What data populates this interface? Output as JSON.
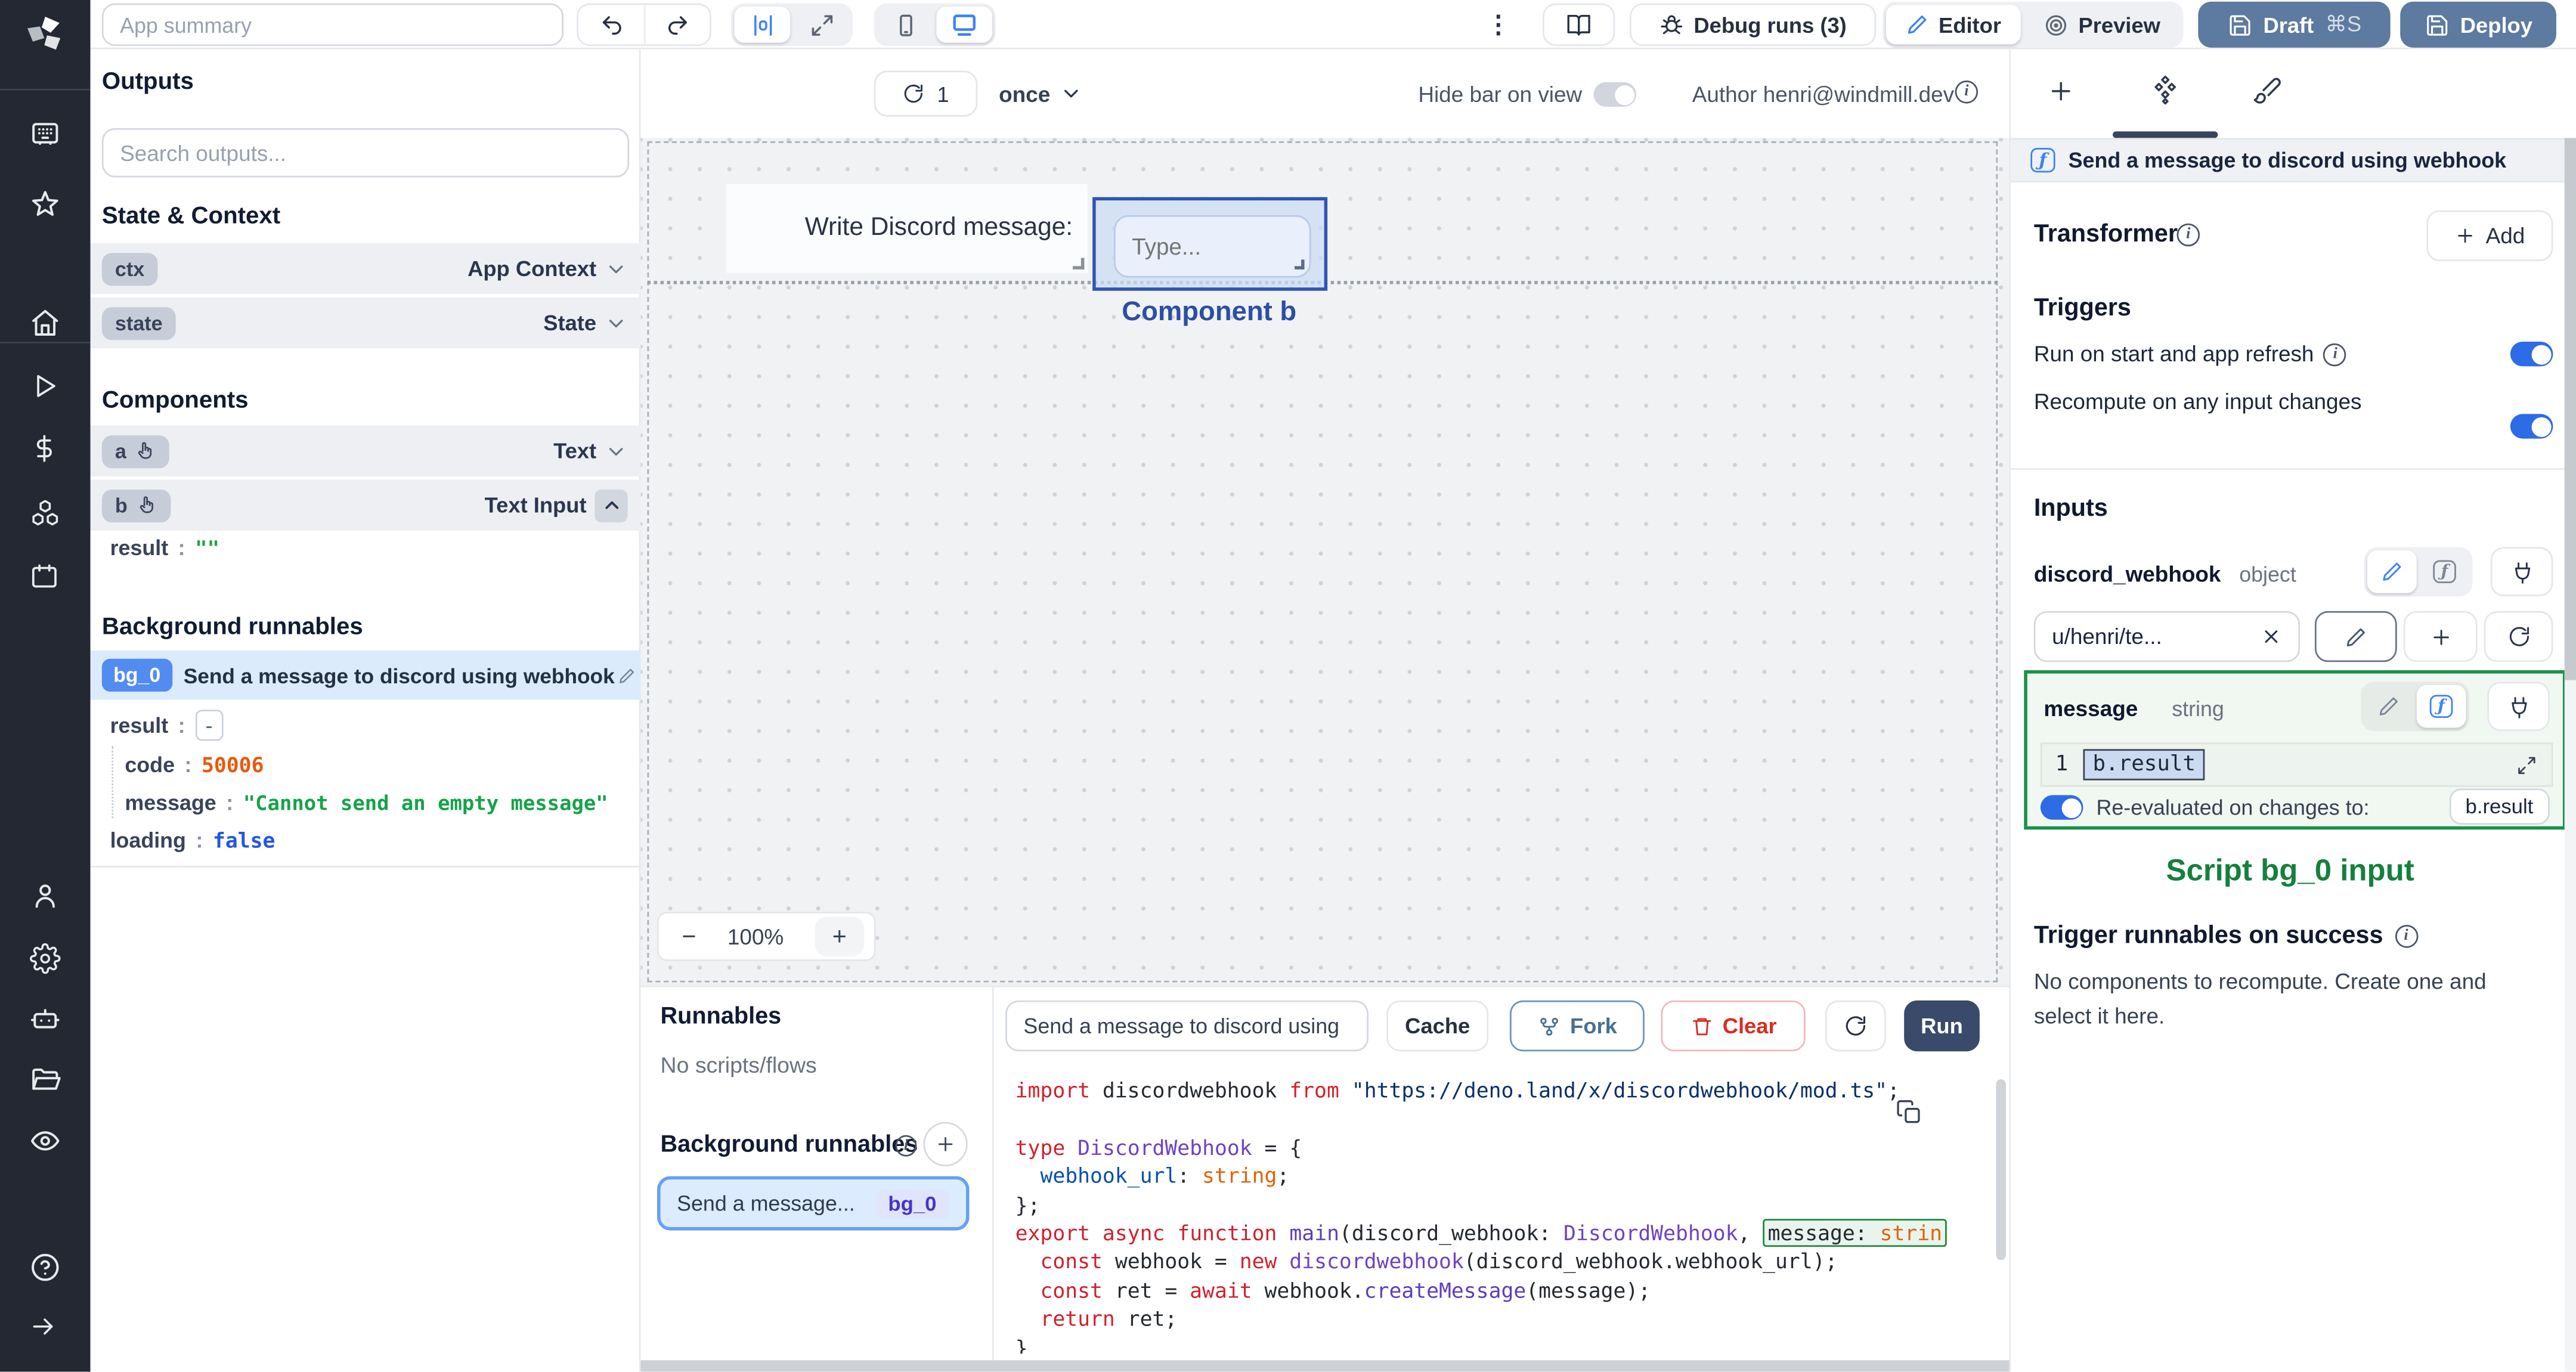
{
  "colors": {
    "accent_blue": "#3b82f6",
    "slate_button": "#5d7aa0",
    "run_button": "#3a4a6b",
    "selection_green": "#199049",
    "component_blue": "#2e55b2",
    "bg0_badge_blue": "#538cf0",
    "code_orange": "#e8590c",
    "code_green": "#16a34a",
    "code_blue": "#2563eb"
  },
  "icons": {
    "rail": [
      "windmill-logo",
      "workspace-keypad",
      "favorites-star",
      "home",
      "runs-play",
      "variables-dollar",
      "resources-cubes",
      "schedules-calendar",
      "user",
      "settings-gear",
      "workers-robot",
      "folders",
      "audit-eye",
      "help-circle",
      "expand-arrow"
    ],
    "topbar": [
      "undo",
      "redo",
      "align-center",
      "fullscreen-expand",
      "mobile",
      "desktop",
      "kebab-menu",
      "book",
      "bug",
      "pencil",
      "preview-target",
      "save"
    ]
  },
  "topbar": {
    "app_summary_placeholder": "App summary",
    "kebab": "⋮",
    "debug_runs_label": "Debug runs (3)",
    "editor_label": "Editor",
    "preview_label": "Preview",
    "draft_label": "Draft",
    "draft_shortcut": "⌘S",
    "deploy_label": "Deploy"
  },
  "outputs": {
    "title": "Outputs",
    "search_placeholder": "Search outputs...",
    "state_context_title": "State & Context",
    "ctx_key": "ctx",
    "ctx_type": "App Context",
    "state_key": "state",
    "state_type": "State",
    "components_title": "Components",
    "comp_a_key": "a",
    "comp_a_type": "Text",
    "comp_b_key": "b",
    "comp_b_type": "Text Input",
    "b_result_key": "result",
    "b_result_value": "\"\"",
    "bg_title": "Background runnables",
    "bg0_badge": "bg_0",
    "bg0_name": "Send a message to discord using webhook",
    "bg0_result_key": "result",
    "bg0_result_collapse": "-",
    "bg0_code_key": "code",
    "bg0_code_value": "50006",
    "bg0_message_key": "message",
    "bg0_message_value": "\"Cannot send an empty message\"",
    "bg0_loading_key": "loading",
    "bg0_loading_value": "false"
  },
  "canvas": {
    "refresh_count": "1",
    "refresh_mode": "once",
    "hide_bar_label": "Hide bar on view",
    "author_label": "Author henri@windmill.dev",
    "text_component": "Write Discord message:",
    "input_placeholder": "Type...",
    "selected_label": "Component b",
    "zoom_out": "−",
    "zoom_value": "100%",
    "zoom_in": "+"
  },
  "runnables": {
    "title": "Runnables",
    "empty": "No scripts/flows",
    "bg_title": "Background runnables",
    "item_label": "Send a message...",
    "item_badge": "bg_0"
  },
  "editor": {
    "name_value": "Send a message to discord using",
    "cache_label": "Cache",
    "fork_label": "Fork",
    "clear_label": "Clear",
    "run_label": "Run",
    "code": [
      [
        [
          "import",
          "k"
        ],
        [
          " discordwebhook ",
          "d"
        ],
        [
          "from",
          "k"
        ],
        [
          " ",
          "d"
        ],
        [
          "\"https://deno.land/x/discordwebhook/mod.ts\"",
          "s"
        ],
        [
          ";",
          "d"
        ]
      ],
      [],
      [
        [
          "type",
          "k"
        ],
        [
          " ",
          "d"
        ],
        [
          "DiscordWebhook",
          "t"
        ],
        [
          " = {",
          "d"
        ]
      ],
      [
        [
          "  ",
          "d"
        ],
        [
          "webhook_url",
          "p"
        ],
        [
          ": ",
          "d"
        ],
        [
          "string",
          "b"
        ],
        [
          ";",
          "d"
        ]
      ],
      [
        [
          "};",
          "d"
        ]
      ],
      [
        [
          "export",
          "k"
        ],
        [
          " ",
          "d"
        ],
        [
          "async",
          "k"
        ],
        [
          " ",
          "d"
        ],
        [
          "function",
          "k"
        ],
        [
          " ",
          "d"
        ],
        [
          "main",
          "fn"
        ],
        [
          "(discord_webhook: ",
          "d"
        ],
        [
          "DiscordWebhook",
          "t"
        ],
        [
          ", ",
          "d"
        ],
        [
          "message:",
          "d",
          "box"
        ],
        [
          " strin",
          "b",
          "box"
        ]
      ],
      [
        [
          "  ",
          "d"
        ],
        [
          "const",
          "k"
        ],
        [
          " webhook = ",
          "d"
        ],
        [
          "new",
          "k"
        ],
        [
          " ",
          "d"
        ],
        [
          "discordwebhook",
          "t"
        ],
        [
          "(discord_webhook.webhook_url);",
          "d"
        ]
      ],
      [
        [
          "  ",
          "d"
        ],
        [
          "const",
          "k"
        ],
        [
          " ret = ",
          "d"
        ],
        [
          "await",
          "k"
        ],
        [
          " webhook.",
          "d"
        ],
        [
          "createMessage",
          "fn"
        ],
        [
          "(message);",
          "d"
        ]
      ],
      [
        [
          "  ",
          "d"
        ],
        [
          "return",
          "k"
        ],
        [
          " ret;",
          "d"
        ]
      ],
      [
        [
          "}",
          "d"
        ]
      ]
    ]
  },
  "right_panel": {
    "header_title": "Send a message to discord using webhook",
    "transformer_title": "Transformer",
    "add_label": "Add",
    "triggers_title": "Triggers",
    "run_on_start_label": "Run on start and app refresh",
    "recompute_label": "Recompute on any input changes",
    "inputs_title": "Inputs",
    "arg1_name": "discord_webhook",
    "arg1_type": "object",
    "arg1_value": "u/henri/te...",
    "arg2_name": "message",
    "arg2_type": "string",
    "arg2_line_no": "1",
    "arg2_expr": "b.result",
    "reeval_label": "Re-evaluated on changes to:",
    "reeval_target": "b.result",
    "caption": "Script bg_0 input",
    "on_success_title": "Trigger runnables on success",
    "on_success_empty": "No components to recompute. Create one and select it here."
  }
}
